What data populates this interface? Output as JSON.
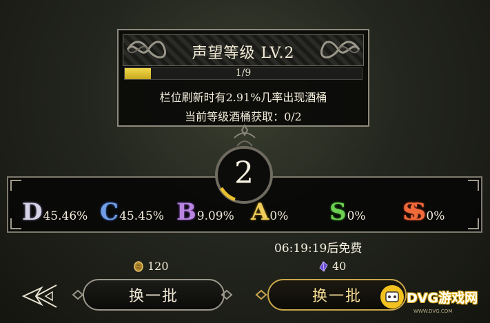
{
  "tooltip": {
    "title": "声望等级 LV.2",
    "progress_text": "1/9",
    "progress_fraction": 0.111,
    "line1": "栏位刷新时有2.91%几率出现酒桶",
    "line2": "当前等级酒桶获取：0/2"
  },
  "level": {
    "number": "2",
    "ring_progress": 0.111
  },
  "rates": [
    {
      "grade": "D",
      "value": "45.46%"
    },
    {
      "grade": "C",
      "value": "45.45%"
    },
    {
      "grade": "B",
      "value": "9.09%"
    },
    {
      "grade": "A",
      "value": "0%"
    },
    {
      "grade": "S",
      "value": "0%"
    },
    {
      "grade": "SS",
      "value": "0%"
    }
  ],
  "free_timer": "06:19:19后免费",
  "costs": {
    "left": {
      "icon": "gold-coin-icon",
      "amount": "120"
    },
    "right": {
      "icon": "purple-gem-icon",
      "amount": "40"
    }
  },
  "buttons": {
    "refresh_left": "换一批",
    "refresh_right": "换一批"
  },
  "watermark": {
    "text": "DVG游戏网",
    "sub": "WWW.DVG.COM"
  },
  "colors": {
    "accent_gold": "#c9a64c",
    "progress_yellow": "#f2d94a",
    "grade_D": "#d6d3e6",
    "grade_C": "#6f9ee6",
    "grade_B": "#b985e0",
    "grade_A": "#f0cc5a",
    "grade_S": "#6cd153",
    "grade_SS": "#f06a3a"
  }
}
